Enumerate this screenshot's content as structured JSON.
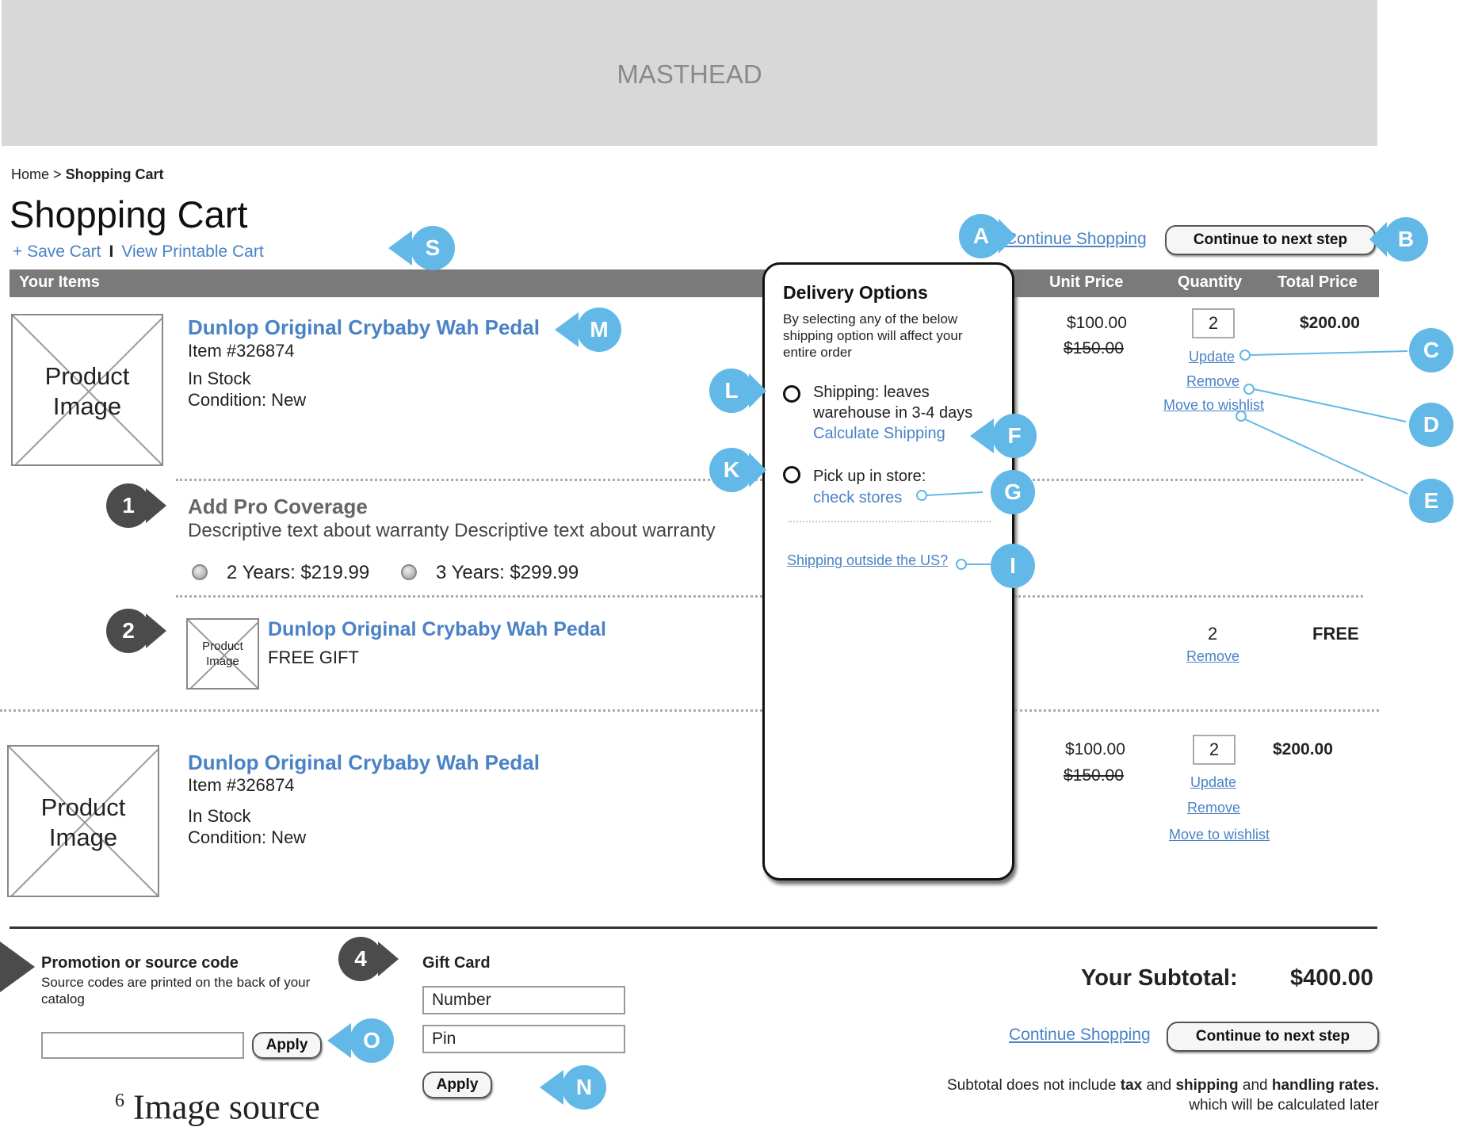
{
  "masthead": {
    "label": "MASTHEAD"
  },
  "breadcrumb": {
    "home": "Home",
    "separator": ">",
    "current": "Shopping Cart"
  },
  "page_title": "Shopping Cart",
  "top_links": {
    "save_cart": "+ Save Cart",
    "divider": "I",
    "printable": "View Printable Cart"
  },
  "header_actions": {
    "continue_shopping": "Continue Shopping",
    "next_step": "Continue to next step"
  },
  "table_header": {
    "your_items": "Your Items",
    "unit_price": "Unit Price",
    "quantity": "Quantity",
    "total_price": "Total Price"
  },
  "items": [
    {
      "title": "Dunlop Original Crybaby Wah Pedal",
      "item_no": "Item #326874",
      "stock": "In Stock",
      "condition": "Condition: New",
      "image_label_1": "Product",
      "image_label_2": "Image",
      "unit_price": "$100.00",
      "old_price": "$150.00",
      "quantity": "2",
      "total": "$200.00",
      "update": "Update",
      "remove": "Remove",
      "wishlist": "Move to wishlist"
    },
    {
      "title": "Dunlop Original Crybaby Wah Pedal",
      "item_no": "Item #326874",
      "stock": "In Stock",
      "condition": "Condition: New",
      "image_label_1": "Product",
      "image_label_2": "Image",
      "unit_price": "$100.00",
      "old_price": "$150.00",
      "quantity": "2",
      "total": "$200.00",
      "update": "Update",
      "remove": "Remove",
      "wishlist": "Move to wishlist"
    }
  ],
  "coverage": {
    "title": "Add Pro Coverage",
    "description": "Descriptive text about warranty Descriptive text about warranty",
    "option_2yr": "2 Years: $219.99",
    "option_3yr": "3 Years: $299.99"
  },
  "gift": {
    "title": "Dunlop Original Crybaby Wah Pedal",
    "subtitle": "FREE GIFT",
    "image_label_1": "Product",
    "image_label_2": "Image",
    "quantity": "2",
    "remove": "Remove",
    "total": "FREE"
  },
  "delivery": {
    "title": "Delivery Options",
    "note": "By selecting any of the below shipping option will affect your entire order",
    "shipping_line1": "Shipping: leaves",
    "shipping_line2": "warehouse in 3-4 days",
    "calculate": "Calculate Shipping",
    "pickup": "Pick up in store:",
    "check_stores": "check stores",
    "outside_us": "Shipping outside the US?"
  },
  "promo": {
    "title": "Promotion or source code",
    "note": "Source codes are printed on the back of your catalog",
    "input_value": "",
    "apply": "Apply"
  },
  "gift_card": {
    "title": "Gift Card",
    "number_value": "Number",
    "pin_value": "Pin",
    "apply": "Apply"
  },
  "summary": {
    "subtotal_label": "Your Subtotal:",
    "subtotal_value": "$400.00",
    "continue_shopping": "Continue Shopping",
    "next_step": "Continue to next step",
    "disclaimer_a": "Subtotal does not include ",
    "tax": "tax",
    "and1": " and ",
    "shipping": "shipping",
    "and2": " and ",
    "handling": "handling rates.",
    "disclaimer_b": "which will be calculated later"
  },
  "footnote": {
    "sup": "6",
    "text": "Image source"
  },
  "markers": {
    "A": "A",
    "B": "B",
    "C": "C",
    "D": "D",
    "E": "E",
    "F": "F",
    "G": "G",
    "I": "I",
    "K": "K",
    "L": "L",
    "M": "M",
    "N": "N",
    "O": "O",
    "S": "S",
    "one": "1",
    "two": "2",
    "four": "4"
  },
  "colors": {
    "link": "#4a82c6",
    "marker_blue": "#62b8e7",
    "marker_gray": "#4b4b4b",
    "masthead": "#d8d8d8",
    "header_bar": "#7a7a7a"
  }
}
